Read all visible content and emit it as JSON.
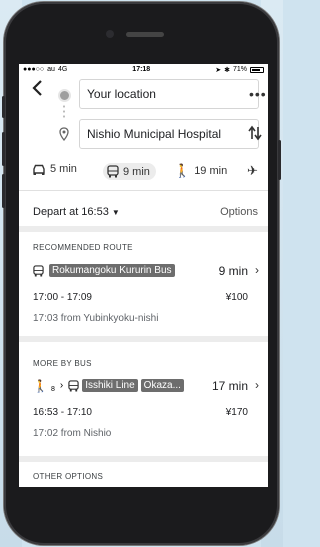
{
  "status_bar": {
    "carrier": "au",
    "network": "4G",
    "time": "17:18",
    "battery": "71%"
  },
  "search": {
    "origin": "Your location",
    "destination": "Nishio Municipal Hospital"
  },
  "icons": {
    "back": "chevron-left-icon",
    "more": "more-horizontal-icon",
    "swap": "swap-vertical-icon",
    "pin": "location-pin-icon"
  },
  "modes": [
    {
      "icon": "car-icon",
      "label": "5 min"
    },
    {
      "icon": "bus-icon",
      "label": "9 min"
    },
    {
      "icon": "walk-icon",
      "label": "19 min"
    },
    {
      "icon": "plane-icon",
      "label": ""
    }
  ],
  "depart": {
    "label": "Depart at 16:53",
    "options": "Options"
  },
  "recommended": {
    "title": "RECOMMENDED ROUTE",
    "bus_name": "Rokumangoku Kururin Bus",
    "duration": "9 min",
    "times": "17:00 - 17:09",
    "fare": "¥100",
    "from": "17:03 from Yubinkyoku-nishi"
  },
  "more_by_bus": {
    "title": "MORE BY BUS",
    "walk_sub": "8",
    "line1": "Isshiki Line",
    "line2": "Okaza...",
    "duration": "17 min",
    "times": "16:53 - 17:10",
    "fare": "¥170",
    "from": "17:02 from Nishio"
  },
  "other": {
    "title": "OTHER OPTIONS"
  }
}
